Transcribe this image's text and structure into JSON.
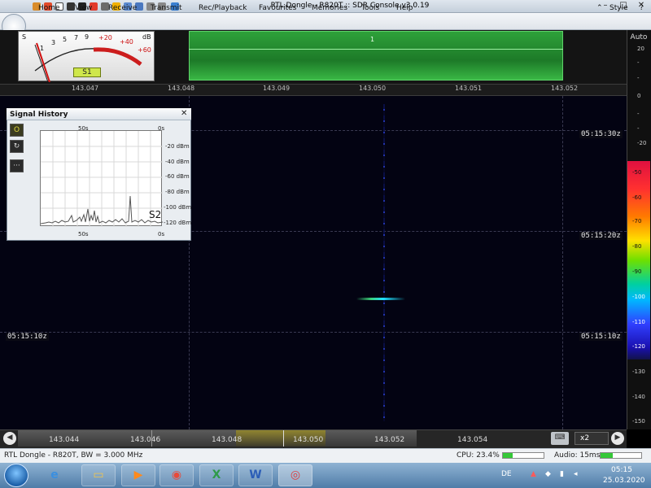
{
  "window": {
    "title": "RTL Dongle - R820T :: SDR Console v3.0.19",
    "style_label": "Style",
    "help_glyph": "?"
  },
  "menu": [
    "Home",
    "View",
    "Receive",
    "Transmit",
    "Rec/Playback",
    "Favourites",
    "Memories",
    "Tools",
    "Help"
  ],
  "smeter": {
    "s_label": "S",
    "db_label": "dB",
    "scale": [
      "1",
      "3",
      "5",
      "7",
      "9",
      "+20",
      "+40",
      "+60"
    ],
    "reading": "S1"
  },
  "signal_marker": "1",
  "frequency_scale": [
    "143.047",
    "143.048",
    "143.049",
    "143.050",
    "143.051",
    "143.052"
  ],
  "waterfall": {
    "timestamps": [
      "05:15:30z",
      "05:15:20z",
      "05:15:10z",
      "05:15:10z"
    ]
  },
  "right_panel": {
    "auto_label": "Auto",
    "ticks": [
      "20",
      "-",
      "-",
      "0",
      "-",
      "-",
      "-20"
    ],
    "color_scale": [
      "-50",
      "-60",
      "-70",
      "-80",
      "-90",
      "-100",
      "-110",
      "-120",
      "-130",
      "-140",
      "-150"
    ]
  },
  "signal_history": {
    "title": "Signal History",
    "top_left": "50s",
    "top_right": "0s",
    "bottom_left": "50s",
    "bottom_right": "0s",
    "db_labels": [
      "-20 dBm",
      "-40 dBm",
      "-60 dBm",
      "-80 dBm",
      "-100 dBm",
      "-120 dBm"
    ],
    "reading": "S2",
    "buttons": [
      "O",
      "↻",
      "···"
    ]
  },
  "bottom_scale": [
    "143.044",
    "143.046",
    "143.048",
    "143.050",
    "143.052",
    "143.054"
  ],
  "zoom": "x2",
  "status": {
    "device": "RTL Dongle - R820T, BW = 3.000 MHz",
    "cpu": "CPU: 23.4%",
    "cpu_level": 0.234,
    "audio": "Audio: 15ms",
    "audio_level": 0.3
  },
  "taskbar": {
    "lang": "DE",
    "time": "05:15",
    "date": "25.03.2020"
  },
  "colors": {
    "accent_green": "#2ea13a",
    "smeter_yellow": "#cfe74b"
  }
}
